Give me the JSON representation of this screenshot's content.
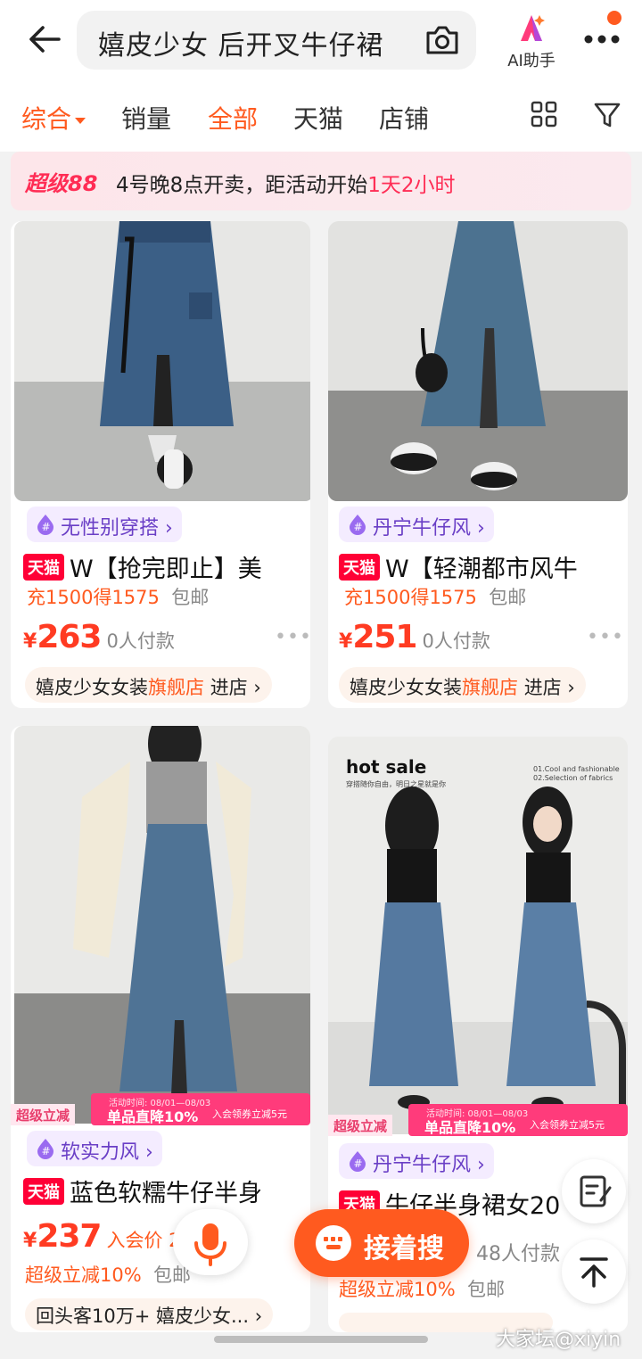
{
  "header": {
    "search_query": "嬉皮少女 后开叉牛仔裙",
    "ai_label": "AI助手",
    "back_icon": "arrow-left-icon",
    "camera_icon": "camera-icon",
    "more_icon": "more-dots-icon"
  },
  "tabs": [
    {
      "label": "综合",
      "active": true
    },
    {
      "label": "销量",
      "active": false
    },
    {
      "label": "全部",
      "active": true
    },
    {
      "label": "天猫",
      "active": false
    },
    {
      "label": "店铺",
      "active": false
    }
  ],
  "banner": {
    "logo": "超级88",
    "text": "4号晚8点开卖，距活动开始",
    "countdown": "1天2小时"
  },
  "products": [
    {
      "tag": "无性别穿搭",
      "badge": "天猫",
      "title": "W【抢完即止】美",
      "promo": "充1500得1575",
      "shipping": "包邮",
      "currency": "¥",
      "price": "263",
      "sold": "0人付款",
      "shop_name": "嬉皮少女女装",
      "shop_hl": "旗舰店",
      "shop_enter": "进店"
    },
    {
      "tag": "丹宁牛仔风",
      "badge": "天猫",
      "title": "W【轻潮都市风牛",
      "promo": "充1500得1575",
      "shipping": "包邮",
      "currency": "¥",
      "price": "251",
      "sold": "0人付款",
      "shop_name": "嬉皮少女女装",
      "shop_hl": "旗舰店",
      "shop_enter": "进店"
    },
    {
      "tag": "软实力风",
      "badge": "天猫",
      "title": "蓝色软糯牛仔半身",
      "currency": "¥",
      "price": "237",
      "sold": "入会价 2",
      "promo": "超级立减10%",
      "shipping": "包邮",
      "shop_name": "回头客10万+ 嬉皮少女...",
      "disc_left": "超级立减",
      "disc_date": "活动时间: 08/01—08/03",
      "disc_main": "单品直降10%",
      "disc_sub": "入会领券立减5元"
    },
    {
      "tag": "丹宁牛仔风",
      "badge": "天猫",
      "title": "牛仔半身裙女20",
      "sold": "48人付款",
      "promo": "超级立减10%",
      "shipping": "包邮",
      "hot_title": "hot sale",
      "hot_sub": "穿搭随你自由，明日之星就是你",
      "hot_r1": "01.Cool and fashionable",
      "hot_r2": "02.Selection of fabrics",
      "disc_left": "超级立减",
      "disc_date": "活动时间: 08/01—08/03",
      "disc_main": "单品直降10%",
      "disc_sub": "入会领券立减5元"
    }
  ],
  "floating": {
    "search_more": "接着搜"
  },
  "watermark": "大家坛@xiyin"
}
